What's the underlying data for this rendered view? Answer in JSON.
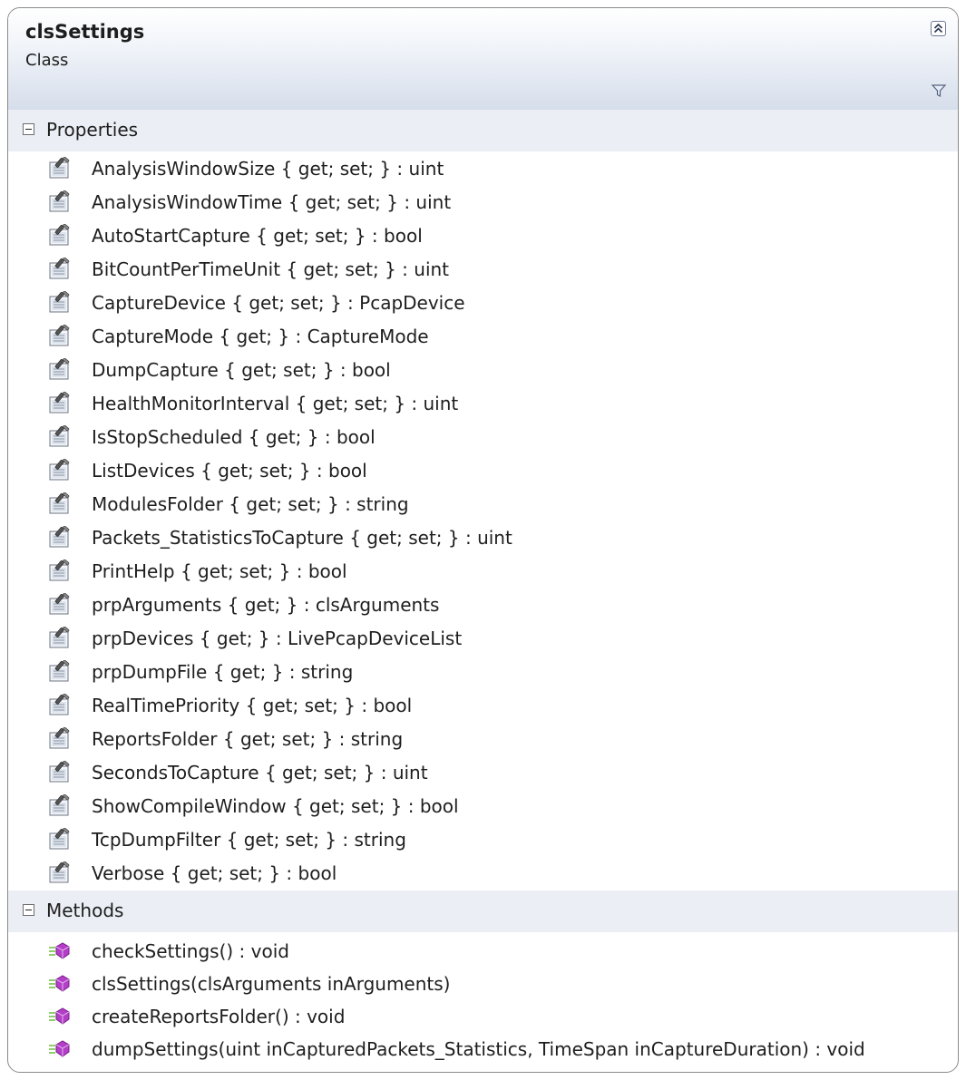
{
  "class": {
    "name": "clsSettings",
    "kind": "Class"
  },
  "icons": {
    "collapse": "double-chevron-up-icon",
    "filter": "filter-icon",
    "property": "property-icon",
    "method": "method-icon"
  },
  "sections": {
    "properties": {
      "label": "Properties",
      "items": [
        "AnalysisWindowSize { get; set; } : uint",
        "AnalysisWindowTime { get; set; } : uint",
        "AutoStartCapture { get; set; } : bool",
        "BitCountPerTimeUnit { get; set; } : uint",
        "CaptureDevice { get; set; } : PcapDevice",
        "CaptureMode { get; } : CaptureMode",
        "DumpCapture { get; set; } : bool",
        "HealthMonitorInterval { get; set; } : uint",
        "IsStopScheduled { get; } : bool",
        "ListDevices { get; set; } : bool",
        "ModulesFolder { get; set; } : string",
        "Packets_StatisticsToCapture { get; set; } : uint",
        "PrintHelp { get; set; } : bool",
        "prpArguments { get; } : clsArguments",
        "prpDevices { get; } : LivePcapDeviceList",
        "prpDumpFile { get; } : string",
        "RealTimePriority { get; set; } : bool",
        "ReportsFolder { get; set; } : string",
        "SecondsToCapture { get; set; } : uint",
        "ShowCompileWindow { get; set; } : bool",
        "TcpDumpFilter { get; set; } : string",
        "Verbose { get; set; } : bool"
      ]
    },
    "methods": {
      "label": "Methods",
      "items": [
        "checkSettings() : void",
        "clsSettings(clsArguments inArguments)",
        "createReportsFolder() : void",
        "dumpSettings(uint inCapturedPackets_Statistics, TimeSpan inCaptureDuration) : void"
      ]
    }
  }
}
